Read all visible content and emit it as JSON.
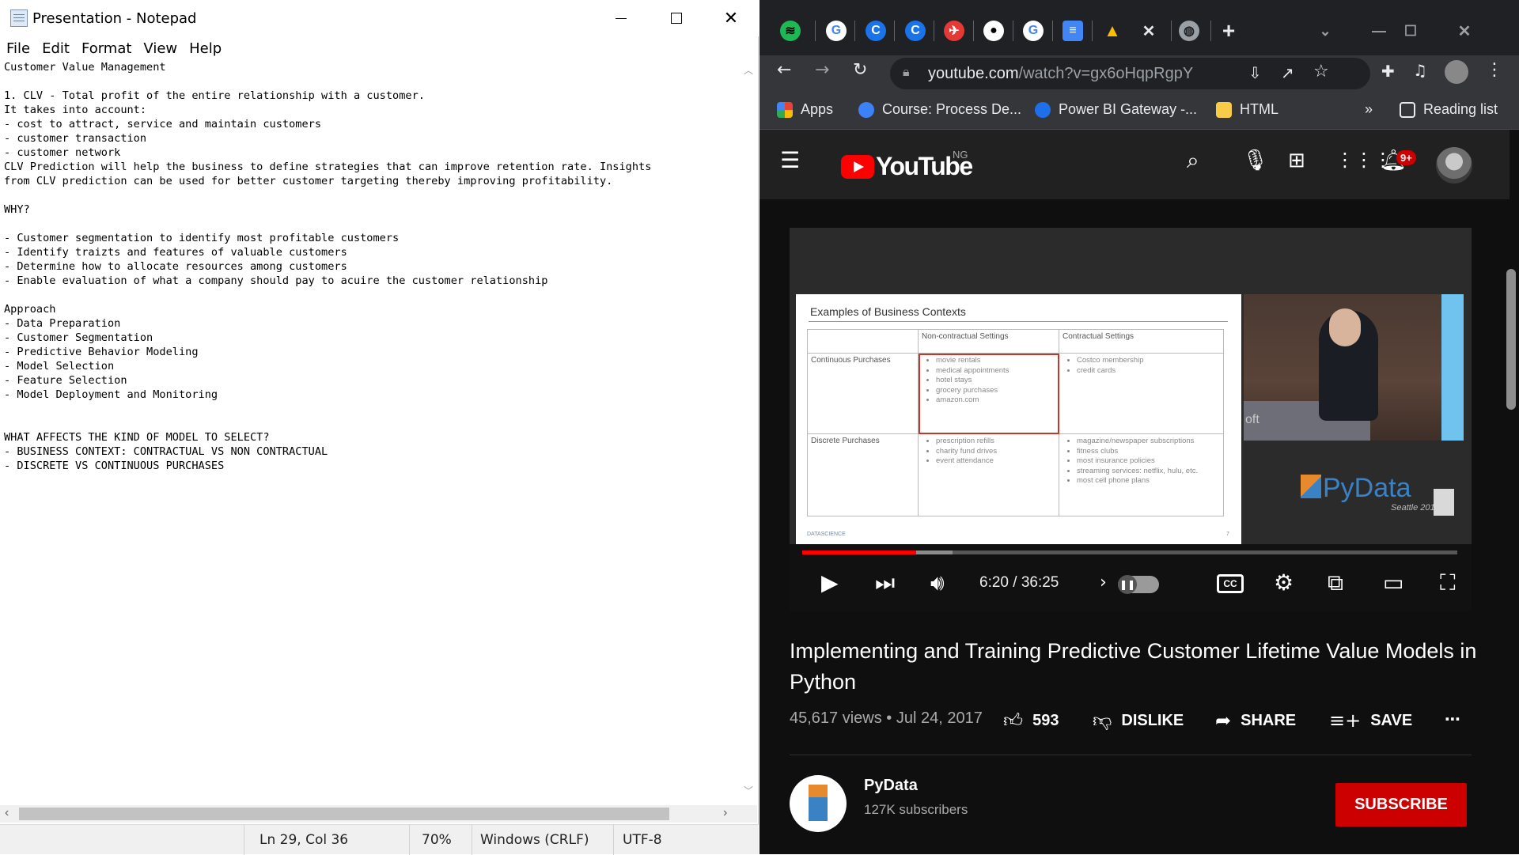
{
  "notepad": {
    "title": "Presentation - Notepad",
    "menu": [
      "File",
      "Edit",
      "Format",
      "View",
      "Help"
    ],
    "content": "Customer Value Management\n\n1. CLV - Total profit of the entire relationship with a customer.\nIt takes into account:\n- cost to attract, service and maintain customers\n- customer transaction\n- customer network\nCLV Prediction will help the business to define strategies that can improve retention rate. Insights\nfrom CLV prediction can be used for better customer targeting thereby improving profitability.\n\nWHY?\n\n- Customer segmentation to identify most profitable customers\n- Identify traizts and features of valuable customers\n- Determine how to allocate resources among customers\n- Enable evaluation of what a company should pay to acuire the customer relationship\n\nApproach\n- Data Preparation\n- Customer Segmentation\n- Predictive Behavior Modeling\n- Model Selection\n- Feature Selection\n- Model Deployment and Monitoring\n\n\nWHAT AFFECTS THE KIND OF MODEL TO SELECT?\n- BUSINESS CONTEXT: CONTRACTUAL VS NON CONTRACTUAL\n- DISCRETE VS CONTINUOUS PURCHASES",
    "status": {
      "position": "Ln 29, Col 36",
      "zoom": "70%",
      "line_ending": "Windows (CRLF)",
      "encoding": "UTF-8"
    }
  },
  "chrome": {
    "url_host": "youtube.com",
    "url_path": "/watch?v=gx6oHqpRgpY",
    "bookmarks": {
      "apps": "Apps",
      "course": "Course: Process De...",
      "powerbi": "Power BI Gateway -...",
      "html": "HTML",
      "reading_list": "Reading list"
    }
  },
  "youtube": {
    "country": "NG",
    "logo_text": "YouTube",
    "notifications": "9+",
    "slide": {
      "title": "Examples of Business Contexts",
      "col1": "Non-contractual Settings",
      "col2": "Contractual Settings",
      "row1": "Continuous Purchases",
      "row2": "Discrete Purchases",
      "r1c1": [
        "movie rentals",
        "medical appointments",
        "hotel stays",
        "grocery purchases",
        "amazon.com"
      ],
      "r1c2": [
        "Costco membership",
        "credit cards"
      ],
      "r2c1": [
        "prescription refills",
        "charity fund drives",
        "event attendance"
      ],
      "r2c2": [
        "magazine/newspaper subscriptions",
        "fitness clubs",
        "most insurance policies",
        "streaming services: netflix, hulu, etc.",
        "most cell phone plans"
      ],
      "footer": "DATASCIENCE",
      "page": "7"
    },
    "speaker_label": "oft",
    "pydata_logo": "PyData",
    "pydata_sub": "Seattle 2017",
    "progress": {
      "played_fraction": 0.174
    },
    "time": "6:20 / 36:25",
    "title": "Implementing and Training Predictive Customer Lifetime Value Models in Python",
    "views": "45,617 views • Jul 24, 2017",
    "likes": "593",
    "dislike": "DISLIKE",
    "share": "SHARE",
    "save": "SAVE",
    "channel": "PyData",
    "subscribers": "127K subscribers",
    "subscribe": "SUBSCRIBE"
  },
  "colors": {
    "yt_red": "#ff0000",
    "subscribe": "#cc0000",
    "chrome_toolbar": "#35363a"
  }
}
